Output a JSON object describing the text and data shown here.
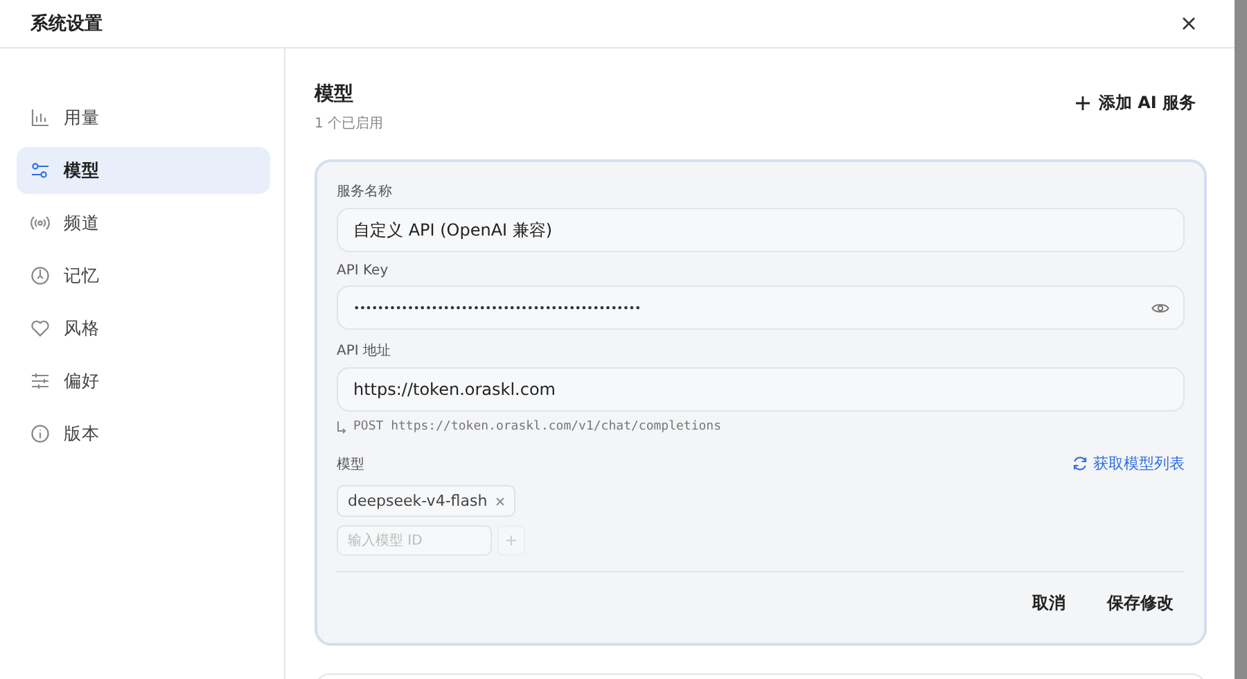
{
  "window": {
    "title": "系统设置"
  },
  "sidebar": {
    "items": [
      {
        "label": "用量",
        "selected": false
      },
      {
        "label": "模型",
        "selected": true
      },
      {
        "label": "频道",
        "selected": false
      },
      {
        "label": "记忆",
        "selected": false
      },
      {
        "label": "风格",
        "selected": false
      },
      {
        "label": "偏好",
        "selected": false
      },
      {
        "label": "版本",
        "selected": false
      }
    ]
  },
  "main": {
    "title": "模型",
    "subtitle": "1 个已启用",
    "add_button": "添加 AI 服务",
    "card": {
      "fields": [
        {
          "kind": "text",
          "label": "服务名称",
          "value": "自定义 API (OpenAI 兼容)"
        },
        {
          "kind": "secret",
          "label": "API Key",
          "value": "••••••••••••••••••••••••••••••••••••••••••••••••"
        },
        {
          "kind": "text",
          "label": "API 地址",
          "value": "https://token.oraskl.com",
          "hint": "POST https://token.oraskl.com/v1/chat/completions"
        }
      ],
      "models": {
        "label": "模型",
        "fetch_button": "获取模型列表",
        "tags": [
          "deepseek-v4-flash"
        ],
        "input_placeholder": "输入模型 ID"
      },
      "buttons": [
        "取消",
        "保存修改"
      ]
    }
  }
}
